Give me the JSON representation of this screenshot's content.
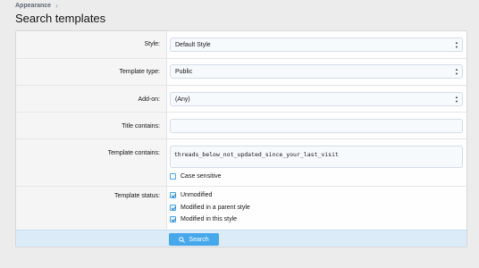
{
  "breadcrumb": {
    "items": [
      "Appearance"
    ]
  },
  "page_title": "Search templates",
  "form": {
    "style": {
      "label": "Style:",
      "value": "Default Style"
    },
    "template_type": {
      "label": "Template type:",
      "value": "Public"
    },
    "addon": {
      "label": "Add-on:",
      "value": "(Any)"
    },
    "title_contains": {
      "label": "Title contains:",
      "value": ""
    },
    "template_contains": {
      "label": "Template contains:",
      "value": "threads_below_not_updated_since_your_last_visit",
      "case_sensitive": {
        "label": "Case sensitive",
        "checked": false
      }
    },
    "template_status": {
      "label": "Template status:",
      "options": [
        {
          "label": "Unmodified",
          "checked": true
        },
        {
          "label": "Modified in a parent style",
          "checked": true
        },
        {
          "label": "Modified in this style",
          "checked": true
        }
      ]
    },
    "submit": {
      "label": "Search",
      "icon": "search-icon"
    }
  },
  "colors": {
    "accent": "#47a7eb",
    "footer": "#dcebf8",
    "page_bg": "#ececec"
  }
}
